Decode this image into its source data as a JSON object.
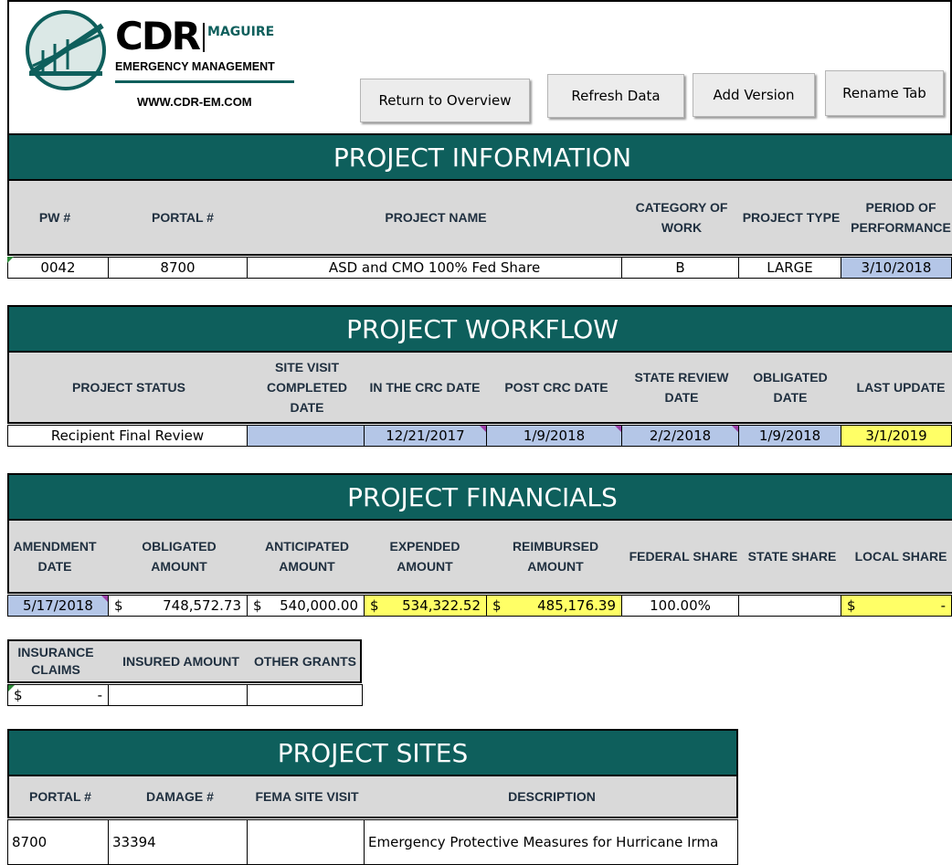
{
  "logo": {
    "brand": "CDR",
    "brand_sub": "MAGUIRE",
    "tagline": "EMERGENCY MANAGEMENT",
    "website": "WWW.CDR-EM.COM",
    "accent": "#0e5f5c"
  },
  "toolbar": {
    "return_label": "Return to Overview",
    "refresh_label": "Refresh Data",
    "add_version_label": "Add Version",
    "rename_label": "Rename Tab"
  },
  "project_info": {
    "title": "PROJECT INFORMATION",
    "headers": [
      "PW #",
      "PORTAL #",
      "PROJECT NAME",
      "CATEGORY OF WORK",
      "PROJECT TYPE",
      "PERIOD OF PERFORMANCE"
    ],
    "row": [
      "0042",
      "8700",
      "ASD and CMO 100% Fed Share",
      "B",
      "LARGE",
      "3/10/2018"
    ]
  },
  "workflow": {
    "title": "PROJECT WORKFLOW",
    "headers": [
      "PROJECT STATUS",
      "SITE VISIT COMPLETED DATE",
      "IN THE CRC DATE",
      "POST CRC DATE",
      "STATE REVIEW DATE",
      "OBLIGATED DATE",
      "LAST UPDATE"
    ],
    "row": [
      "Recipient Final Review",
      "",
      "12/21/2017",
      "1/9/2018",
      "2/2/2018",
      "1/9/2018",
      "3/1/2019"
    ]
  },
  "financials": {
    "title": "PROJECT FINANCIALS",
    "headers": [
      "AMENDMENT DATE",
      "OBLIGATED AMOUNT",
      "ANTICIPATED AMOUNT",
      "EXPENDED AMOUNT",
      "REIMBURSED AMOUNT",
      "FEDERAL SHARE",
      "STATE SHARE",
      "LOCAL SHARE"
    ],
    "amendment_date": "5/17/2018",
    "currency": "$",
    "obligated": "748,572.73",
    "anticipated": "540,000.00",
    "expended": "534,322.52",
    "reimbursed": "485,176.39",
    "federal_share": "100.00%",
    "state_share": "",
    "local_share": "-"
  },
  "insurance": {
    "headers": [
      "INSURANCE CLAIMS",
      "INSURED AMOUNT",
      "OTHER GRANTS"
    ],
    "claims_currency": "$",
    "claims_value": "-",
    "insured_amount": "",
    "other_grants": ""
  },
  "sites": {
    "title": "PROJECT SITES",
    "headers": [
      "PORTAL #",
      "DAMAGE #",
      "FEMA SITE VISIT",
      "DESCRIPTION"
    ],
    "rows": [
      {
        "portal": "8700",
        "damage": "33394",
        "fema_visit": "",
        "description": "Emergency Protective Measures for Hurricane Irma"
      }
    ]
  }
}
